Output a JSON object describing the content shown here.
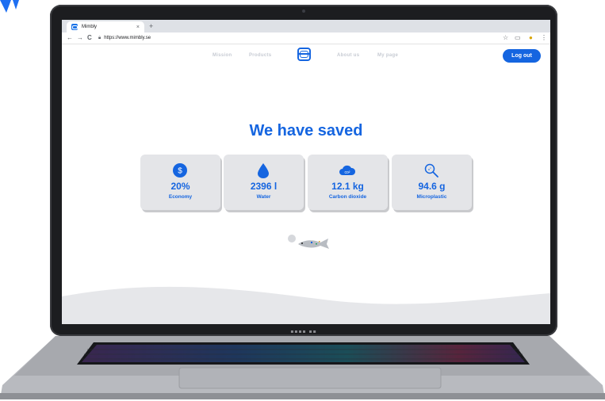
{
  "browser": {
    "tab_title": "Mimbly",
    "tab_close": "×",
    "new_tab": "+",
    "url": "https://www.mimbly.se",
    "nav": {
      "back": "←",
      "forward": "→",
      "reload": "C"
    }
  },
  "site": {
    "nav_items": [
      "Mission",
      "Products",
      "About us",
      "My page"
    ],
    "logout_label": "Log out",
    "heading": "We have saved",
    "stats": [
      {
        "icon": "dollar-icon",
        "value": "20%",
        "label": "Economy"
      },
      {
        "icon": "water-drop-icon",
        "value": "2396 l",
        "label": "Water"
      },
      {
        "icon": "co2-cloud-icon",
        "value": "12.1 kg",
        "label": "Carbon dioxide"
      },
      {
        "icon": "magnifier-icon",
        "value": "94.6 g",
        "label": "Microplastic"
      }
    ]
  },
  "colors": {
    "accent": "#1565e0",
    "card_bg": "#e4e5e8",
    "nav_inactive": "#c7cbd3"
  }
}
